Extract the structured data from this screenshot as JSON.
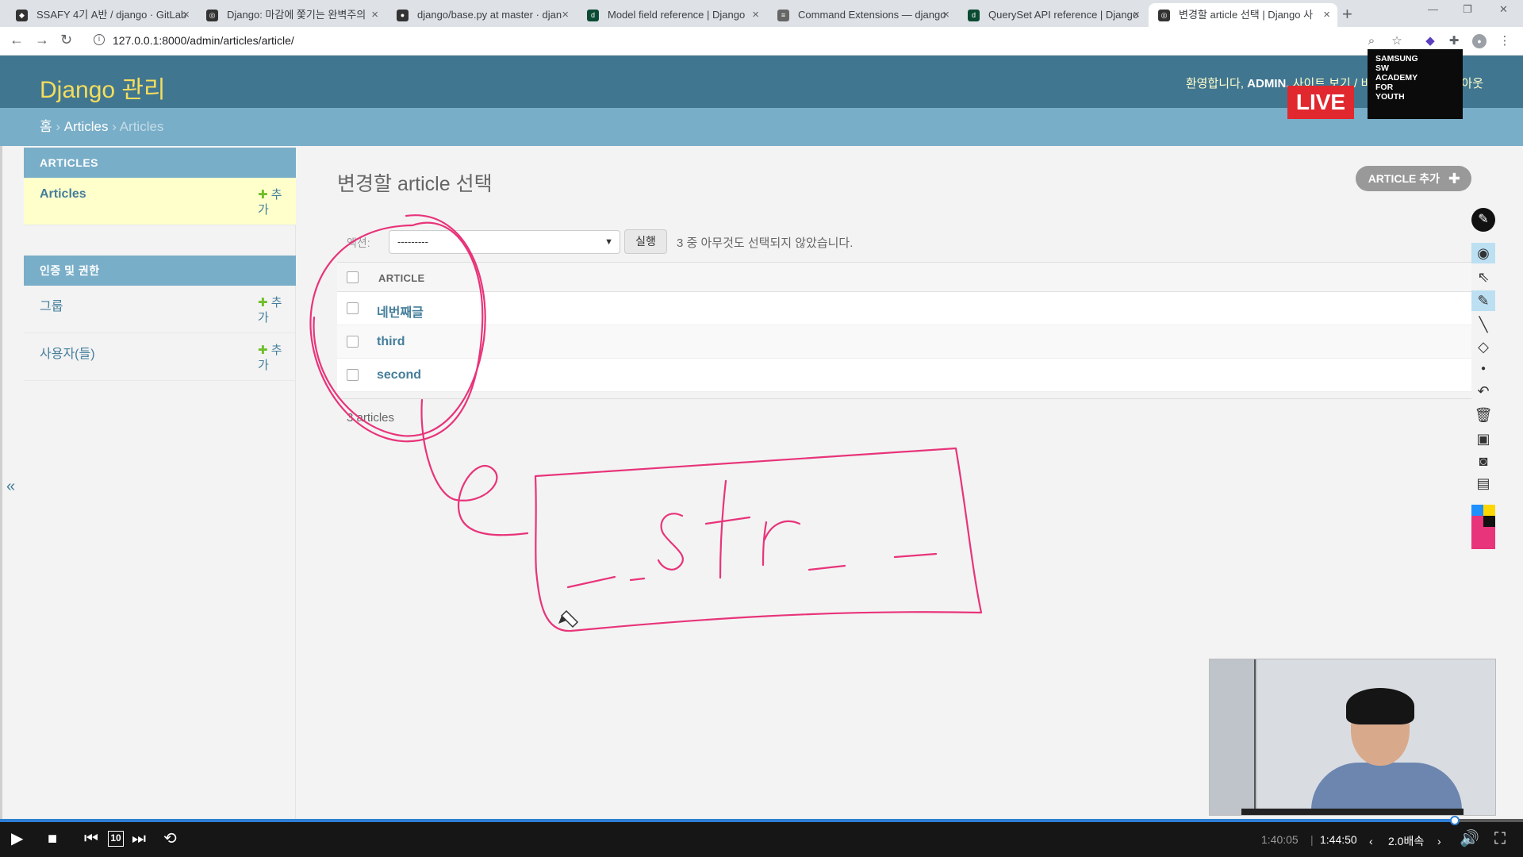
{
  "browser": {
    "tabs": [
      {
        "title": "SSAFY 4기 A반 / django · GitLab"
      },
      {
        "title": "Django: 마감에 쫓기는 완벽주의"
      },
      {
        "title": "django/base.py at master · djan"
      },
      {
        "title": "Model field reference | Django"
      },
      {
        "title": "Command Extensions — django"
      },
      {
        "title": "QuerySet API reference | Django"
      },
      {
        "title": "변경할 article 선택 | Django 사"
      }
    ],
    "url": "127.0.0.1:8000/admin/articles/article/"
  },
  "admin": {
    "brand": "Django 관리",
    "welcome": "환영합니다,",
    "user": "ADMIN.",
    "links": "사이트 보기 / 비밀번호 변경 / 로그아웃",
    "breadcrumb": {
      "home": "홈",
      "app": "Articles",
      "current": "Articles"
    }
  },
  "sidebar": {
    "modules": [
      {
        "caption": "ARTICLES",
        "items": [
          {
            "label": "Articles",
            "add": "추가"
          }
        ]
      },
      {
        "caption": "인증 및 권한",
        "items": [
          {
            "label": "그룹",
            "add": "추가"
          },
          {
            "label": "사용자(들)",
            "add": "추가"
          }
        ]
      }
    ],
    "collapse": "«"
  },
  "changelist": {
    "title": "변경할 article 선택",
    "add_button": "ARTICLE 추가",
    "action_label": "액션:",
    "action_selected": "---------",
    "run_button": "실행",
    "selection_counter": "3 중 아무것도 선택되지 않았습니다.",
    "column_header": "ARTICLE",
    "rows": [
      "네번째글",
      "third",
      "second"
    ],
    "paginator": "3 articles"
  },
  "overlays": {
    "live": "LIVE",
    "academy": [
      "SAMSUNG",
      "SW",
      "ACADEMY",
      "FOR",
      "YOUTH"
    ],
    "annotation_text": "__str__"
  },
  "player": {
    "current_time": "1:40:05",
    "total_time": "1:44:50",
    "speed": "2.0배속",
    "skip_seconds": "10",
    "progress_fraction": 0.955
  },
  "colors": {
    "header": "#417690",
    "breadcrumbs": "#79aec8",
    "brand": "#f5dd5d",
    "ink": "#e8347a",
    "live": "#e0282e"
  }
}
